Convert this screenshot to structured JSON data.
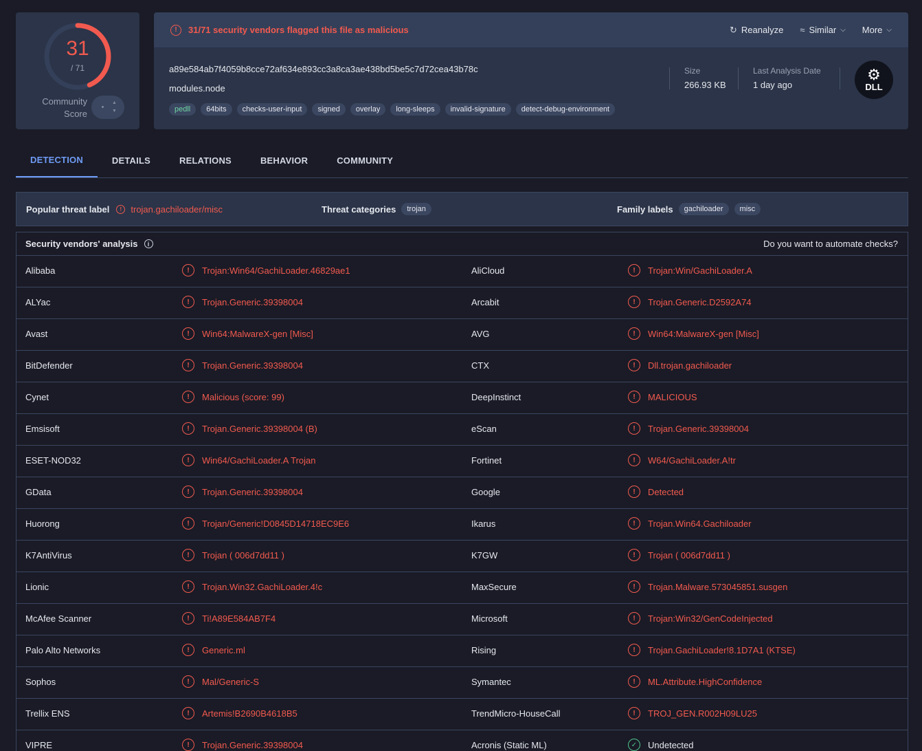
{
  "score": {
    "detections": "31",
    "total": "/ 71",
    "community_label_1": "Community",
    "community_label_2": "Score"
  },
  "alert": {
    "text": "31/71 security vendors flagged this file as malicious"
  },
  "actions": {
    "reanalyze": "Reanalyze",
    "similar": "Similar",
    "more": "More"
  },
  "file": {
    "hash": "a89e584ab7f4059b8cce72af634e893cc3a8ca3ae438bd5be5c7d72cea43b78c",
    "name": "modules.node",
    "tags": [
      "pedll",
      "64bits",
      "checks-user-input",
      "signed",
      "overlay",
      "long-sleeps",
      "invalid-signature",
      "detect-debug-environment"
    ],
    "size_label": "Size",
    "size_value": "266.93 KB",
    "date_label": "Last Analysis Date",
    "date_value": "1 day ago",
    "type_badge": "DLL"
  },
  "tabs": [
    "DETECTION",
    "DETAILS",
    "RELATIONS",
    "BEHAVIOR",
    "COMMUNITY"
  ],
  "threat": {
    "popular_label": "Popular threat label",
    "popular_value": "trojan.gachiloader/misc",
    "categories_label": "Threat categories",
    "categories": [
      "trojan"
    ],
    "family_label": "Family labels",
    "families": [
      "gachiloader",
      "misc"
    ]
  },
  "vendors_section": {
    "title": "Security vendors' analysis",
    "automate": "Do you want to automate checks?"
  },
  "vendors": [
    [
      {
        "name": "Alibaba",
        "result": "Trojan:Win64/GachiLoader.46829ae1",
        "status": "malicious"
      },
      {
        "name": "AliCloud",
        "result": "Trojan:Win/GachiLoader.A",
        "status": "malicious"
      }
    ],
    [
      {
        "name": "ALYac",
        "result": "Trojan.Generic.39398004",
        "status": "malicious"
      },
      {
        "name": "Arcabit",
        "result": "Trojan.Generic.D2592A74",
        "status": "malicious"
      }
    ],
    [
      {
        "name": "Avast",
        "result": "Win64:MalwareX-gen [Misc]",
        "status": "malicious"
      },
      {
        "name": "AVG",
        "result": "Win64:MalwareX-gen [Misc]",
        "status": "malicious"
      }
    ],
    [
      {
        "name": "BitDefender",
        "result": "Trojan.Generic.39398004",
        "status": "malicious"
      },
      {
        "name": "CTX",
        "result": "Dll.trojan.gachiloader",
        "status": "malicious"
      }
    ],
    [
      {
        "name": "Cynet",
        "result": "Malicious (score: 99)",
        "status": "malicious"
      },
      {
        "name": "DeepInstinct",
        "result": "MALICIOUS",
        "status": "malicious"
      }
    ],
    [
      {
        "name": "Emsisoft",
        "result": "Trojan.Generic.39398004 (B)",
        "status": "malicious"
      },
      {
        "name": "eScan",
        "result": "Trojan.Generic.39398004",
        "status": "malicious"
      }
    ],
    [
      {
        "name": "ESET-NOD32",
        "result": "Win64/GachiLoader.A Trojan",
        "status": "malicious"
      },
      {
        "name": "Fortinet",
        "result": "W64/GachiLoader.A!tr",
        "status": "malicious"
      }
    ],
    [
      {
        "name": "GData",
        "result": "Trojan.Generic.39398004",
        "status": "malicious"
      },
      {
        "name": "Google",
        "result": "Detected",
        "status": "malicious"
      }
    ],
    [
      {
        "name": "Huorong",
        "result": "Trojan/Generic!D0845D14718EC9E6",
        "status": "malicious"
      },
      {
        "name": "Ikarus",
        "result": "Trojan.Win64.Gachiloader",
        "status": "malicious"
      }
    ],
    [
      {
        "name": "K7AntiVirus",
        "result": "Trojan ( 006d7dd11 )",
        "status": "malicious"
      },
      {
        "name": "K7GW",
        "result": "Trojan ( 006d7dd11 )",
        "status": "malicious"
      }
    ],
    [
      {
        "name": "Lionic",
        "result": "Trojan.Win32.GachiLoader.4!c",
        "status": "malicious"
      },
      {
        "name": "MaxSecure",
        "result": "Trojan.Malware.573045851.susgen",
        "status": "malicious"
      }
    ],
    [
      {
        "name": "McAfee Scanner",
        "result": "Ti!A89E584AB7F4",
        "status": "malicious"
      },
      {
        "name": "Microsoft",
        "result": "Trojan:Win32/GenCodeInjected",
        "status": "malicious"
      }
    ],
    [
      {
        "name": "Palo Alto Networks",
        "result": "Generic.ml",
        "status": "malicious"
      },
      {
        "name": "Rising",
        "result": "Trojan.GachiLoader!8.1D7A1 (KTSE)",
        "status": "malicious"
      }
    ],
    [
      {
        "name": "Sophos",
        "result": "Mal/Generic-S",
        "status": "malicious"
      },
      {
        "name": "Symantec",
        "result": "ML.Attribute.HighConfidence",
        "status": "malicious"
      }
    ],
    [
      {
        "name": "Trellix ENS",
        "result": "Artemis!B2690B4618B5",
        "status": "malicious"
      },
      {
        "name": "TrendMicro-HouseCall",
        "result": "TROJ_GEN.R002H09LU25",
        "status": "malicious"
      }
    ],
    [
      {
        "name": "VIPRE",
        "result": "Trojan.Generic.39398004",
        "status": "malicious"
      },
      {
        "name": "Acronis (Static ML)",
        "result": "Undetected",
        "status": "undetected"
      }
    ]
  ],
  "colors": {
    "background": "#1a1b26",
    "card": "#2b3448",
    "malicious": "#f25a4f",
    "clean": "#4ec58c",
    "accent": "#6f9bf5"
  }
}
